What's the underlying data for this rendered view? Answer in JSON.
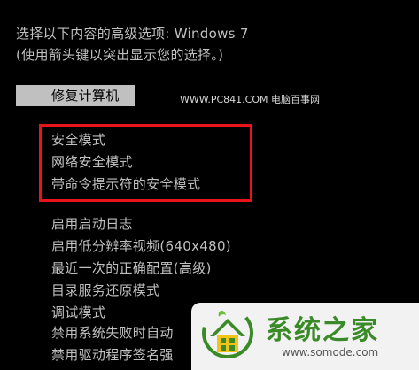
{
  "header": {
    "title_line": "选择以下内容的高级选项: Windows 7",
    "instruction_line": "(使用箭头键以突出显示您的选择。)"
  },
  "highlighted_option": "修复计算机",
  "watermark_top": "WWW.PC841.COM 电脑百事网",
  "safe_mode_options": [
    "安全模式",
    "网络安全模式",
    "带命令提示符的安全模式"
  ],
  "other_options": [
    "启用启动日志",
    "启用低分辨率视频(640x480)",
    "最近一次的正确配置(高级)",
    "目录服务还原模式",
    "调试模式",
    "禁用系统失败时自动",
    "禁用驱动程序签名强"
  ],
  "logo": {
    "title": "系统之家",
    "url": "www.somode.com",
    "brand_color": "#3a8a28"
  },
  "colors": {
    "background": "#000000",
    "text": "#c0c0c0",
    "highlight": "#c0c0c0",
    "annotation_box": "#e8141c"
  }
}
